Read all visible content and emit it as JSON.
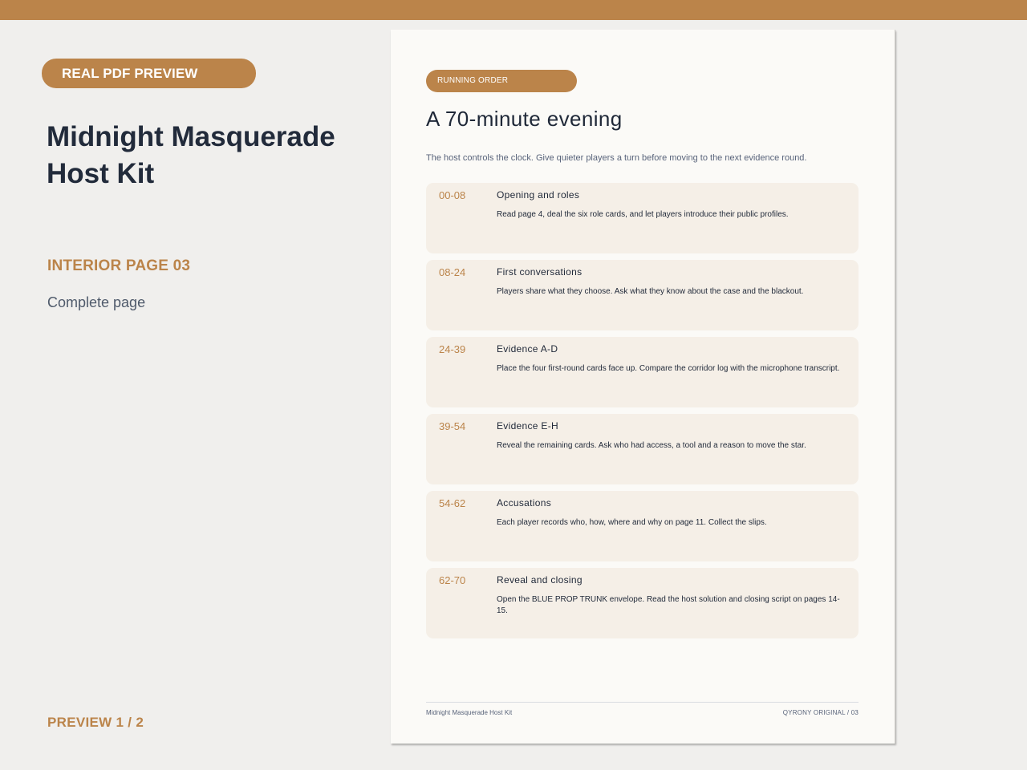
{
  "colors": {
    "accent": "#bb844a",
    "ink": "#222b3b",
    "muted": "#58637a",
    "background": "#f0efed",
    "paper": "#fbfaf7",
    "card": "#f5efe7"
  },
  "sidebar": {
    "badge": "REAL PDF PREVIEW",
    "title": "Midnight Masquerade Host Kit",
    "page_label": "INTERIOR PAGE 03",
    "status": "Complete page",
    "counter": "PREVIEW 1 / 2"
  },
  "page": {
    "section_label": "RUNNING ORDER",
    "heading": "A 70-minute evening",
    "intro": "The host controls the clock. Give quieter players a turn before moving to the next evidence round.",
    "schedule": [
      {
        "time": "00-08",
        "title": "Opening and roles",
        "desc": "Read page 4, deal the six role cards, and let players introduce their public profiles."
      },
      {
        "time": "08-24",
        "title": "First conversations",
        "desc": "Players share what they choose. Ask what they know about the case and the blackout."
      },
      {
        "time": "24-39",
        "title": "Evidence A-D",
        "desc": "Place the four first-round cards face up. Compare the corridor log with the microphone transcript."
      },
      {
        "time": "39-54",
        "title": "Evidence E-H",
        "desc": "Reveal the remaining cards. Ask who had access, a tool and a reason to move the star."
      },
      {
        "time": "54-62",
        "title": "Accusations",
        "desc": "Each player records who, how, where and why on page 11. Collect the slips."
      },
      {
        "time": "62-70",
        "title": "Reveal and closing",
        "desc": "Open the BLUE PROP TRUNK envelope. Read the host solution and closing script on pages 14-15."
      }
    ],
    "footer_left": "Midnight Masquerade Host Kit",
    "footer_right": "QYRONY ORIGINAL  /  03"
  }
}
